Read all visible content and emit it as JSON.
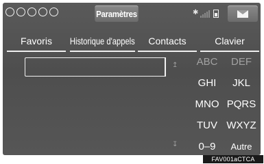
{
  "header": {
    "title": "Paramètres",
    "radio_dots": 5
  },
  "tabs": [
    {
      "label": "Favoris"
    },
    {
      "label": "Historique d'appels"
    },
    {
      "label": "Contacts"
    },
    {
      "label": "Clavier"
    }
  ],
  "search": {
    "value": ""
  },
  "keypad": {
    "keys": [
      "ABC",
      "DEF",
      "GHI",
      "JKL",
      "MNO",
      "PQRS",
      "TUV",
      "WXYZ",
      "0–9",
      "Autre"
    ]
  },
  "figure_id": "FAV001aCTCA",
  "colors": {
    "screen_bg": "#545454",
    "text": "#ffffff",
    "dim_text": "#a2a2a2"
  }
}
